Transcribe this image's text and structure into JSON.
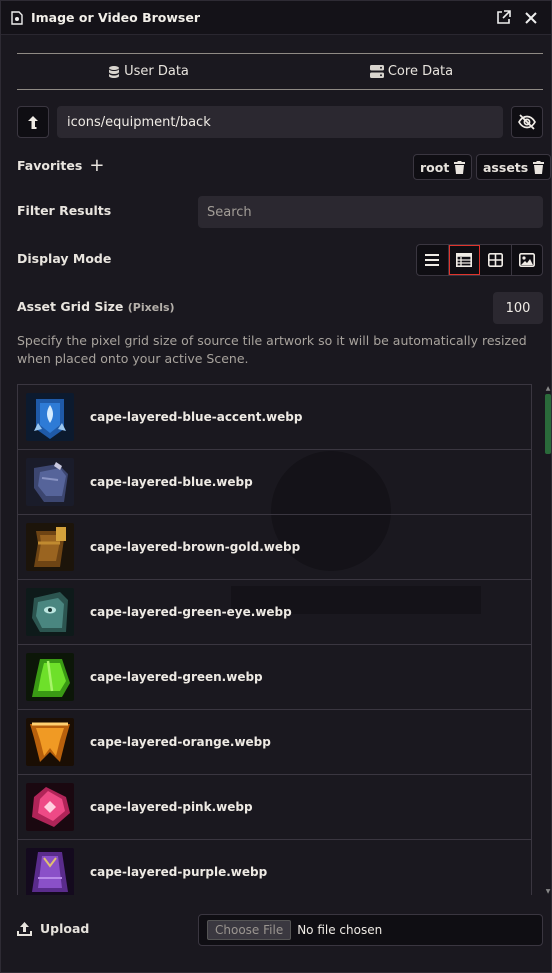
{
  "window": {
    "title": "Image or Video Browser"
  },
  "tabs": [
    {
      "label": "User Data",
      "icon": "database-icon"
    },
    {
      "label": "Core Data",
      "icon": "server-icon"
    }
  ],
  "path": {
    "value": "icons/equipment/back"
  },
  "favorites": {
    "label": "Favorites",
    "add_icon": "plus-icon",
    "tags": [
      {
        "label": "root",
        "icon": "trash-icon"
      },
      {
        "label": "assets",
        "icon": "trash-icon"
      }
    ]
  },
  "filter": {
    "label": "Filter Results",
    "placeholder": "Search"
  },
  "display": {
    "label": "Display Mode",
    "modes": [
      "list-icon",
      "table-icon",
      "grid-icon",
      "image-icon"
    ],
    "active": 1
  },
  "grid": {
    "label": "Asset Grid Size",
    "sublabel": "(Pixels)",
    "value": "100",
    "hint": "Specify the pixel grid size of source tile artwork so it will be automatically resized when placed onto your active Scene."
  },
  "files": [
    {
      "name": "cape-layered-blue-accent.webp",
      "color": "#2e7bd6"
    },
    {
      "name": "cape-layered-blue.webp",
      "color": "#4a5a8c"
    },
    {
      "name": "cape-layered-brown-gold.webp",
      "color": "#8a5a1c"
    },
    {
      "name": "cape-layered-green-eye.webp",
      "color": "#3e6e68"
    },
    {
      "name": "cape-layered-green.webp",
      "color": "#4fbf1e"
    },
    {
      "name": "cape-layered-orange.webp",
      "color": "#d67a14"
    },
    {
      "name": "cape-layered-pink.webp",
      "color": "#e0467a"
    },
    {
      "name": "cape-layered-purple.webp",
      "color": "#7a44b4"
    }
  ],
  "upload": {
    "label": "Upload",
    "button": "Choose File",
    "status": "No file chosen"
  },
  "colors": {
    "accent": "#e0342c",
    "scroll": "#2a6a3a"
  }
}
